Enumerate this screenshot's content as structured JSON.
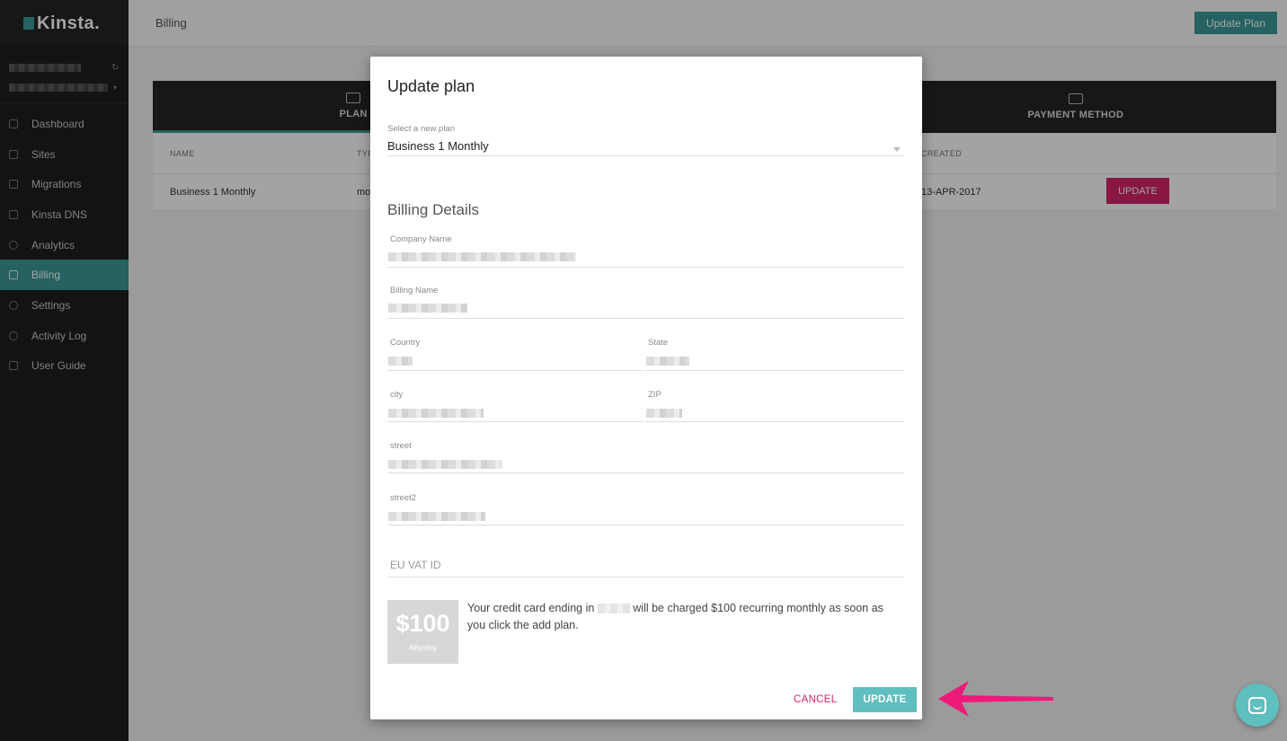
{
  "sidebar": {
    "logo": "Kinsta.",
    "items": [
      {
        "label": "Dashboard",
        "icon": "home-icon"
      },
      {
        "label": "Sites",
        "icon": "monitor-icon"
      },
      {
        "label": "Migrations",
        "icon": "download-icon"
      },
      {
        "label": "Kinsta DNS",
        "icon": "grid-icon"
      },
      {
        "label": "Analytics",
        "icon": "pie-chart-icon"
      },
      {
        "label": "Billing",
        "icon": "credit-card-icon",
        "active": true
      },
      {
        "label": "Settings",
        "icon": "gear-icon"
      },
      {
        "label": "Activity Log",
        "icon": "eye-icon"
      },
      {
        "label": "User Guide",
        "icon": "book-icon"
      }
    ]
  },
  "header": {
    "title": "Billing",
    "update_plan_button": "Update Plan"
  },
  "panel": {
    "tabs": [
      {
        "label": "PLAN",
        "icon": "building-icon",
        "active": true
      },
      {
        "label": "PAYMENT METHOD",
        "icon": "credit-card-icon"
      }
    ],
    "columns": [
      "NAME",
      "TYP",
      "CREATED"
    ],
    "row": {
      "name": "Business 1 Monthly",
      "type": "mo",
      "created": "13-APR-2017",
      "action": "UPDATE"
    }
  },
  "modal": {
    "title": "Update plan",
    "plan_select": {
      "label": "Select a new plan",
      "value": "Business 1 Monthly"
    },
    "billing_details_title": "Billing Details",
    "fields": {
      "company_name": "Company Name",
      "billing_name": "Billing Name",
      "country": "Country",
      "state": "State",
      "city": "city",
      "zip": "ZIP",
      "street": "street",
      "street2": "street2"
    },
    "vat_placeholder": "EU VAT ID",
    "price": {
      "amount": "$100",
      "period": "/Monthly"
    },
    "charge_text_before": "Your credit card ending in",
    "charge_text_after": "will be charged $100 recurring monthly as soon as you click the add plan.",
    "cancel_label": "CANCEL",
    "update_label": "UPDATE"
  },
  "colors": {
    "accent": "#3a9a98",
    "danger": "#d5256a",
    "annotation": "#ee1a7a"
  }
}
